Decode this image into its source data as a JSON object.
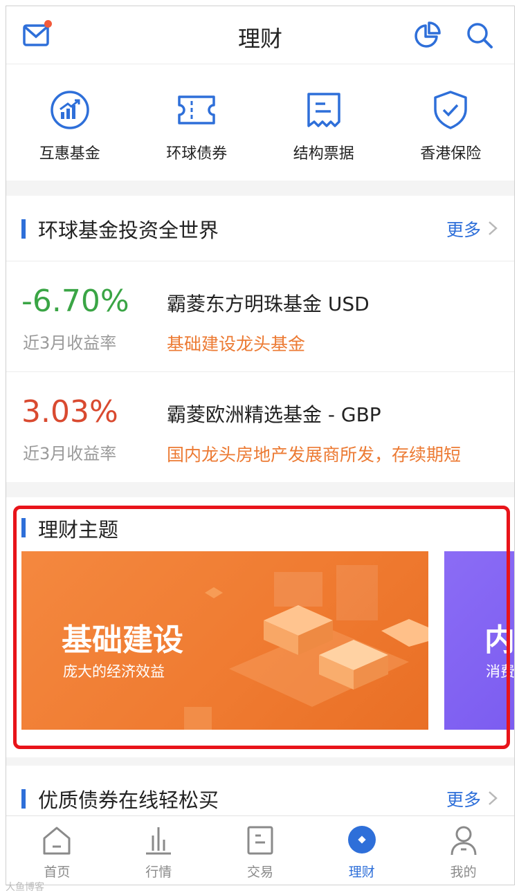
{
  "header": {
    "title": "理财"
  },
  "quicknav": [
    {
      "label": "互惠基金",
      "icon": "fund-chart-icon"
    },
    {
      "label": "环球债券",
      "icon": "ticket-icon"
    },
    {
      "label": "结构票据",
      "icon": "receipt-icon"
    },
    {
      "label": "香港保险",
      "icon": "shield-check-icon"
    }
  ],
  "global_funds": {
    "title": "环球基金投资全世界",
    "more": "更多",
    "items": [
      {
        "rate": "-6.70%",
        "rate_label": "近3月收益率",
        "name": "霸菱东方明珠基金 USD",
        "desc": "基础建设龙头基金"
      },
      {
        "rate": "3.03%",
        "rate_label": "近3月收益率",
        "name": "霸菱欧洲精选基金 - GBP",
        "desc": "国内龙头房地产发展商所发，存续期短"
      }
    ]
  },
  "themes": {
    "title": "理财主题",
    "banners": [
      {
        "title": "基础建设",
        "subtitle": "庞大的经济效益"
      },
      {
        "title": "内",
        "subtitle": "消费"
      }
    ]
  },
  "bonds": {
    "title": "优质债券在线轻松买",
    "more": "更多"
  },
  "tabbar": [
    {
      "label": "首页",
      "icon": "home-icon",
      "active": false
    },
    {
      "label": "行情",
      "icon": "bar-chart-icon",
      "active": false
    },
    {
      "label": "交易",
      "icon": "trade-icon",
      "active": false
    },
    {
      "label": "理财",
      "icon": "wealth-icon",
      "active": true
    },
    {
      "label": "我的",
      "icon": "user-icon",
      "active": false
    }
  ],
  "watermark": "大鱼博客",
  "colors": {
    "accent": "#2e6fd9",
    "gain": "#d94a30",
    "loss": "#3aa545",
    "tag": "#ec7a33",
    "highlight": "#e8141a"
  }
}
